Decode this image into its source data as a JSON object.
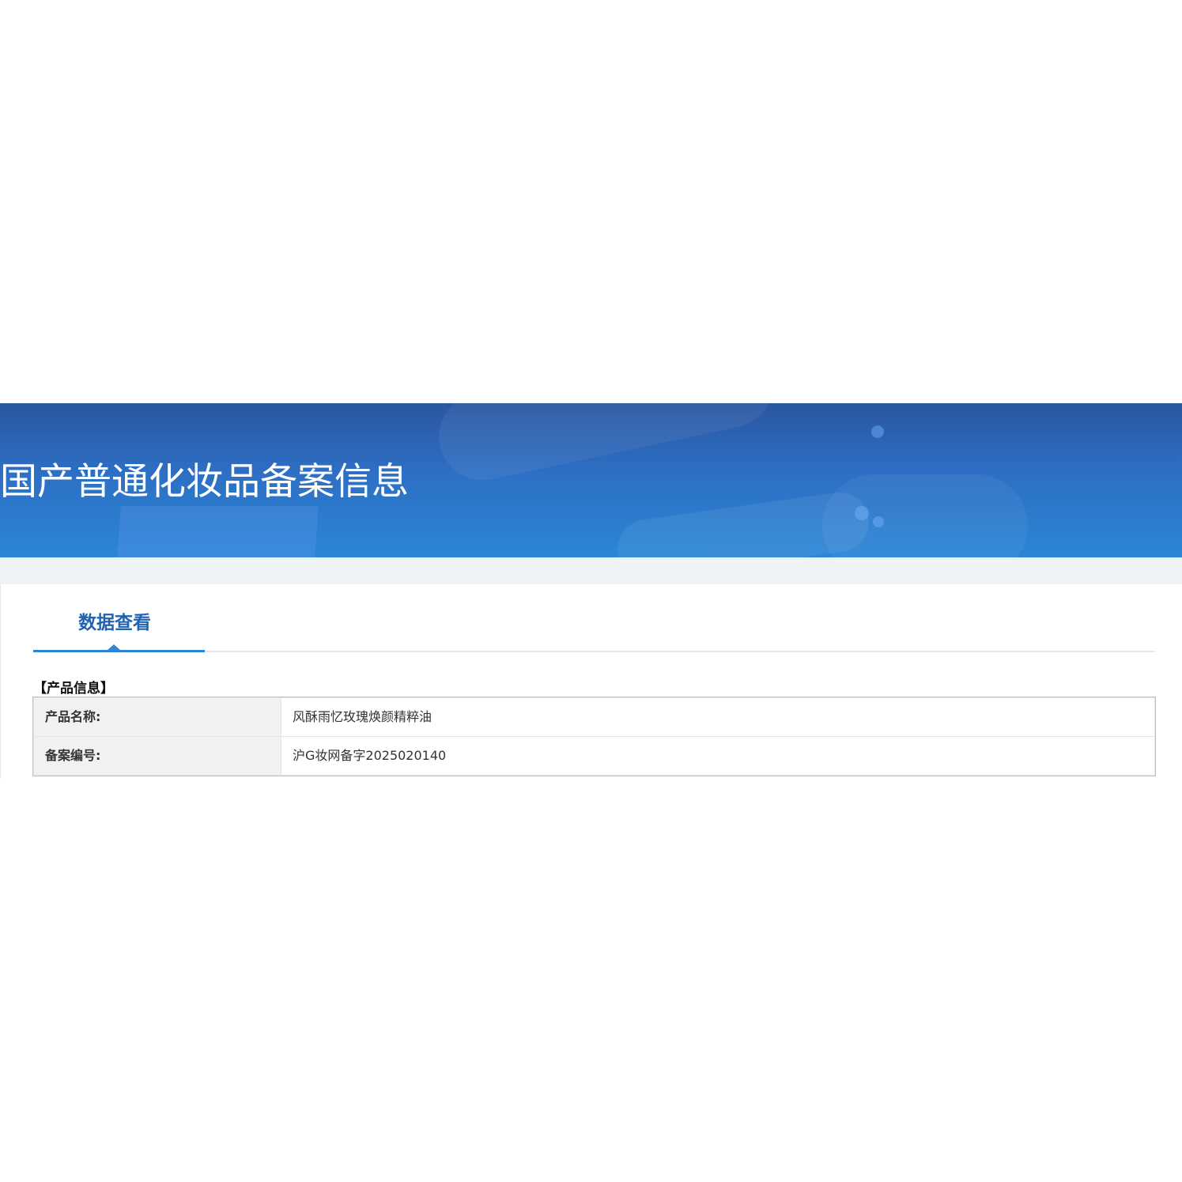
{
  "banner": {
    "title": "国产普通化妆品备案信息",
    "colors": {
      "top": "#2b56a0",
      "bottom": "#2b86d6"
    }
  },
  "tabs": [
    {
      "label": "数据查看",
      "active": true
    }
  ],
  "section": {
    "title": "【产品信息】"
  },
  "product_info": {
    "rows": [
      {
        "label": "产品名称:",
        "value": "风酥雨忆玫瑰焕颜精粹油"
      },
      {
        "label": "备案编号:",
        "value": "沪G妆网备字2025020140"
      }
    ]
  },
  "colors": {
    "accent": "#2d86d3",
    "tab_text": "#1f63b0",
    "label_bg": "#f1f1f1",
    "strip_bg": "#eff3f6"
  }
}
